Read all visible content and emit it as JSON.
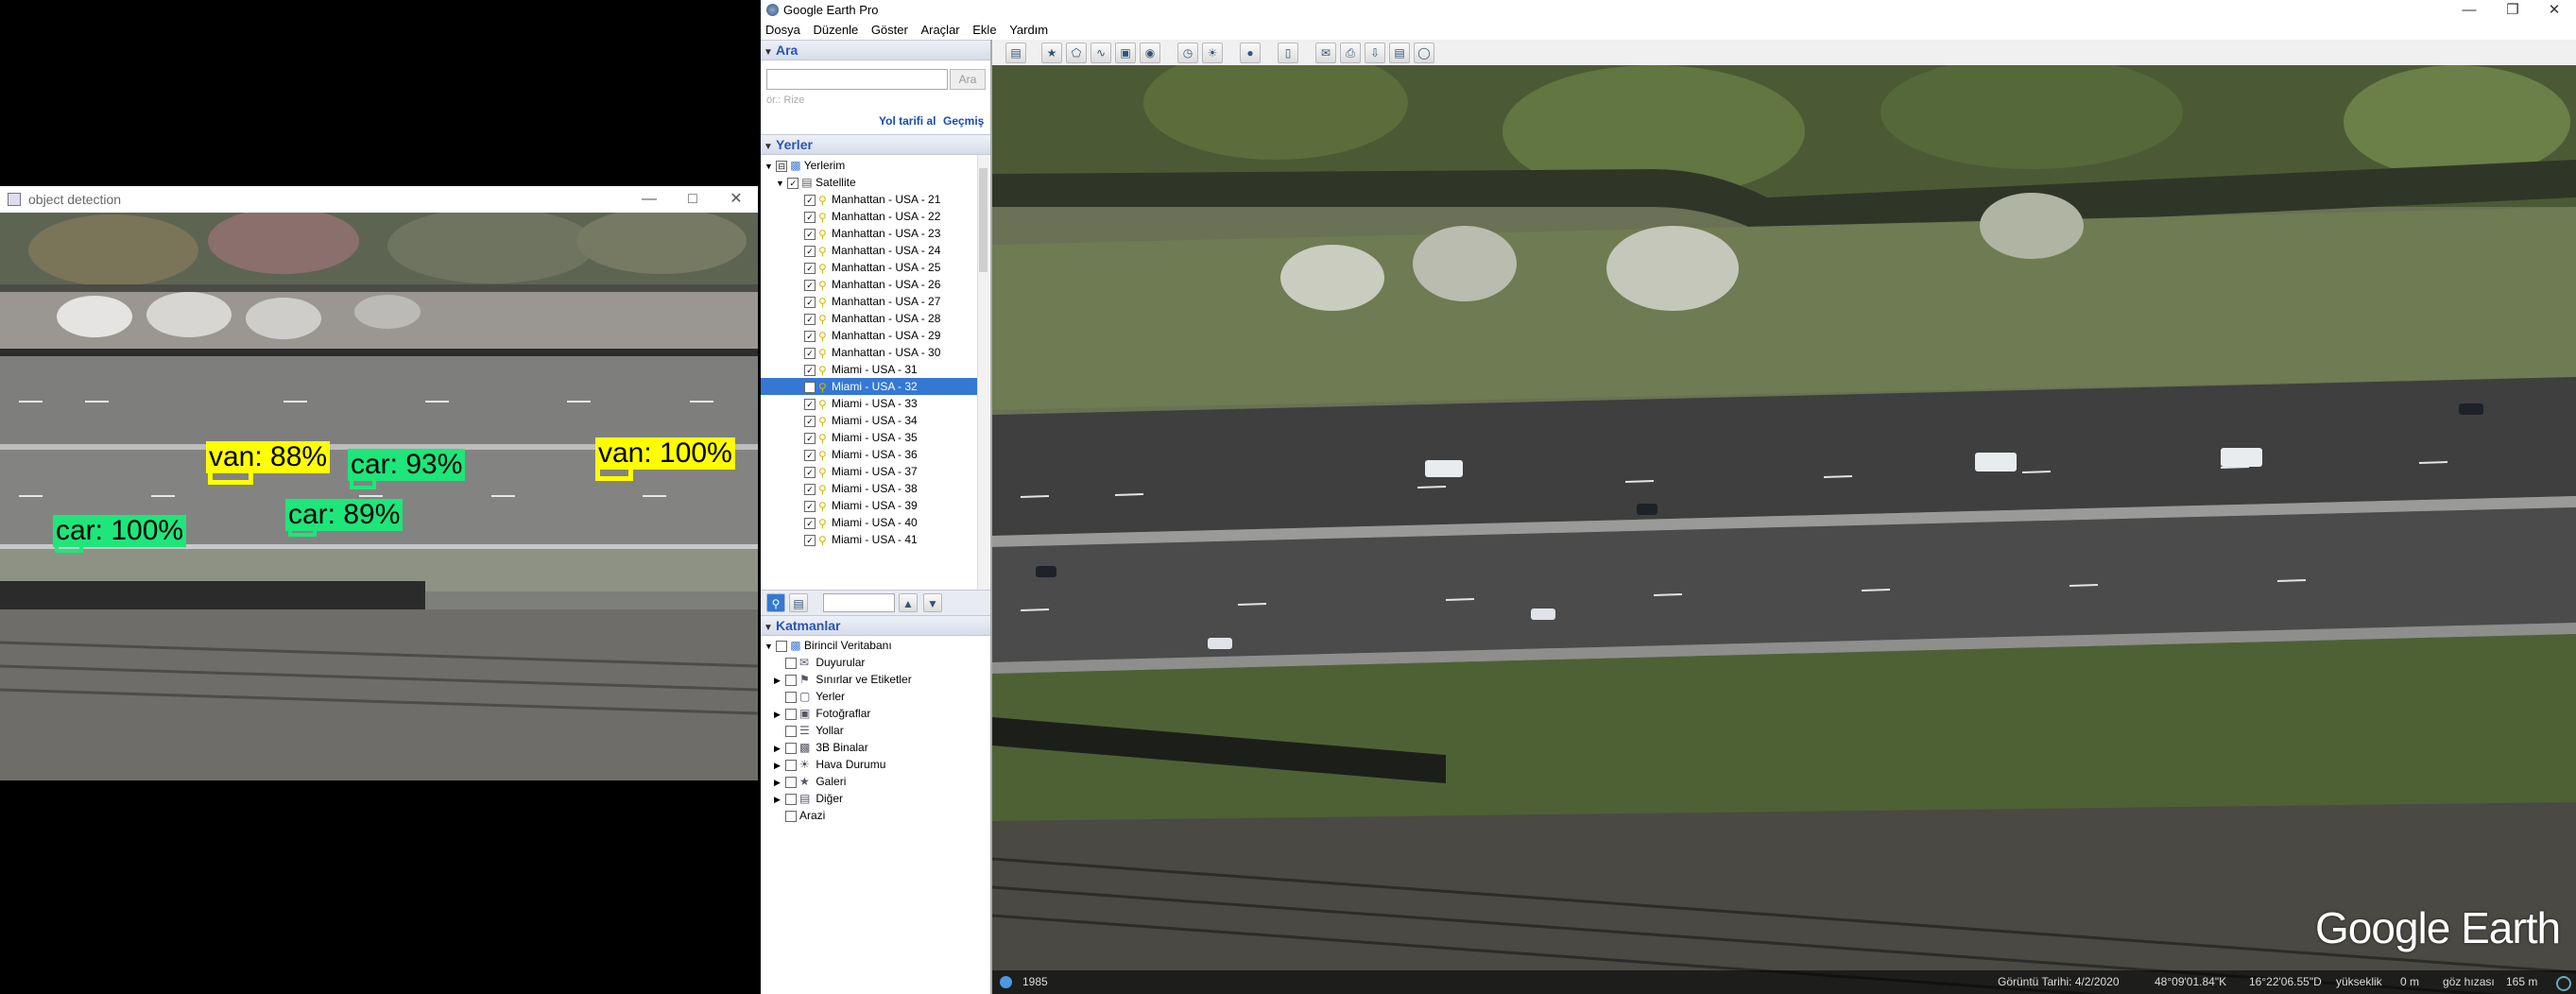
{
  "od_window": {
    "title": "object detection",
    "detections": [
      {
        "label": "van: 88%",
        "color": "#ffff00"
      },
      {
        "label": "car: 93%",
        "color": "#1ee67a"
      },
      {
        "label": "van: 100%",
        "color": "#ffff00"
      },
      {
        "label": "car: 89%",
        "color": "#1ee67a"
      },
      {
        "label": "car: 100%",
        "color": "#1ee67a"
      }
    ]
  },
  "ge": {
    "title": "Google Earth Pro",
    "menu": [
      "Dosya",
      "Düzenle",
      "Göster",
      "Araçlar",
      "Ekle",
      "Yardım"
    ],
    "search": {
      "header": "Ara",
      "button": "Ara",
      "hint": "ör.: Rize",
      "link_directions": "Yol tarifi al",
      "link_history": "Geçmiş"
    },
    "places": {
      "header": "Yerler",
      "root": "Yerlerim",
      "folder": "Satellite",
      "items": [
        "Manhattan - USA - 21",
        "Manhattan - USA - 22",
        "Manhattan - USA - 23",
        "Manhattan - USA - 24",
        "Manhattan - USA - 25",
        "Manhattan - USA - 26",
        "Manhattan - USA - 27",
        "Manhattan - USA - 28",
        "Manhattan - USA - 29",
        "Manhattan - USA - 30",
        "Miami - USA - 31",
        "Miami - USA - 32",
        "Miami - USA - 33",
        "Miami - USA - 34",
        "Miami - USA - 35",
        "Miami - USA - 36",
        "Miami - USA - 37",
        "Miami - USA - 38",
        "Miami - USA - 39",
        "Miami - USA - 40",
        "Miami - USA - 41"
      ],
      "selected": "Miami - USA - 32"
    },
    "layers": {
      "header": "Katmanlar",
      "root": "Birincil Veritabanı",
      "items": [
        "Duyurular",
        "Sınırlar ve Etiketler",
        "Yerler",
        "Fotoğraflar",
        "Yollar",
        "3B Binalar",
        "Hava Durumu",
        "Galeri",
        "Diğer"
      ],
      "terrain": "Arazi"
    },
    "status": {
      "year": "1985",
      "imagery_date": "Görüntü Tarihi: 4/2/2020",
      "lat": "48°09'01.84\"K",
      "lon": "16°22'06.55\"D",
      "elev_label": "yükseklik",
      "elev_value": "0 m",
      "eye_label": "göz hızası",
      "eye_value": "165 m"
    },
    "logo": "Google Earth"
  }
}
